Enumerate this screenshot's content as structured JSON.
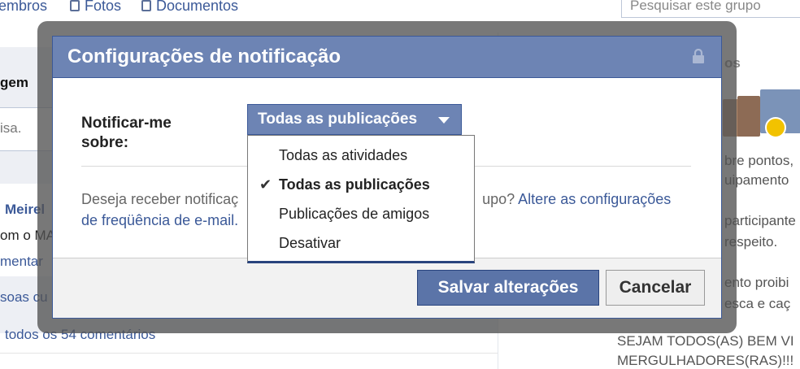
{
  "background": {
    "tabs": [
      "embros",
      "Fotos",
      "Documentos"
    ],
    "search_placeholder": "Pesquisar este grupo",
    "left_texts": [
      "gem",
      "isa.",
      "Meirel",
      "om o MA",
      "mentar",
      "soas cu",
      "todos os 54 comentários"
    ],
    "right_texts": [
      "os",
      "bre pontos,",
      "uipamento",
      "participante",
      "respeito.",
      "ento proibi",
      "esca e caç",
      "SEJAM TODOS(AS) BEM VI",
      "MERGULHADORES(RAS)!!!"
    ]
  },
  "dialog": {
    "title": "Configurações de notificação",
    "label_line1": "Notificar-me",
    "label_line2": "sobre:",
    "dropdown": {
      "selected": "Todas as publicações",
      "options": [
        "Todas as atividades",
        "Todas as publicações",
        "Publicações de amigos",
        "Desativar"
      ],
      "selected_index": 1
    },
    "info_prefix": "Deseja receber notificaç",
    "info_mid": "upo?",
    "info_link_a": "Altere as configurações",
    "info_link_b": "de freqüência de e-mail.",
    "save_label": "Salvar alterações",
    "cancel_label": "Cancelar"
  },
  "colors": {
    "header": "#6d84b4",
    "primary_button": "#5b74a8",
    "link": "#3b5998"
  }
}
